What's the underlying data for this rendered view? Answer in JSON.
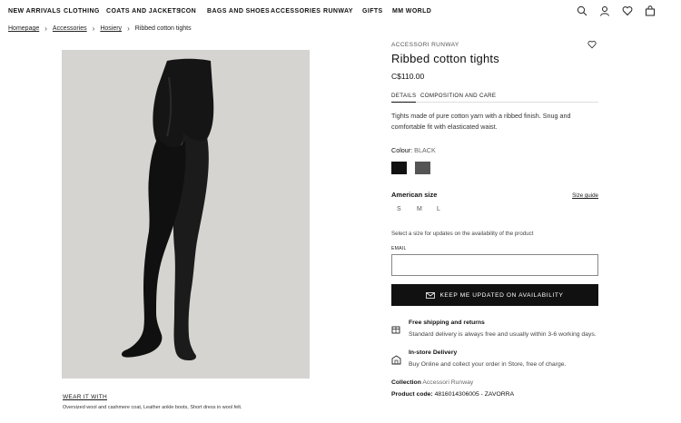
{
  "nav": {
    "items": [
      "NEW ARRIVALS",
      "CLOTHING",
      "COATS AND JACKETS",
      "ICON",
      "BAGS AND SHOES",
      "ACCESSORIES",
      "RUNWAY",
      "GIFTS",
      "MM WORLD"
    ],
    "icons": [
      "search-icon",
      "account-icon",
      "wishlist-icon",
      "bag-icon"
    ]
  },
  "breadcrumb": [
    "Homepage",
    "Accessories",
    "Hosiery",
    "Ribbed cotton tights"
  ],
  "product": {
    "brand": "ACCESSORI RUNWAY",
    "title": "Ribbed cotton tights",
    "price": "C$110.00",
    "tabs": [
      "DETAILS",
      "COMPOSITION AND CARE"
    ],
    "description": "Tights made of pure cotton yarn with a ribbed finish. Snug and comfortable fit with elasticated waist.",
    "colour_label": "Colour:",
    "colour_value": "BLACK",
    "swatches": [
      "#111111",
      "#555555"
    ],
    "size_title": "American size",
    "size_guide": "Size guide",
    "sizes": [
      "S",
      "M",
      "L"
    ],
    "size_hint": "Select a size for updates on the availability of the product",
    "email_label": "EMAIL",
    "email_value": "",
    "keep_button": "KEEP ME UPDATED ON AVAILABILITY"
  },
  "services": [
    {
      "icon": "shipping-icon",
      "title": "Free shipping and returns",
      "text": "Standard delivery is always free and usually within 3-6 working days."
    },
    {
      "icon": "store-delivery-icon",
      "title": "In-store Delivery",
      "text": "Buy Online and collect your order in Store, free of charge."
    }
  ],
  "meta": {
    "collection_label": "Collection",
    "collection_value": "Accessori Runway",
    "code_label": "Product code:",
    "code_value": "4816014306005 - ZAVORRA"
  },
  "wear_it": {
    "label": "WEAR IT WITH",
    "desc": "Oversized wool and cashmere coat, Leather ankle boots, Short dress in wool felt."
  }
}
